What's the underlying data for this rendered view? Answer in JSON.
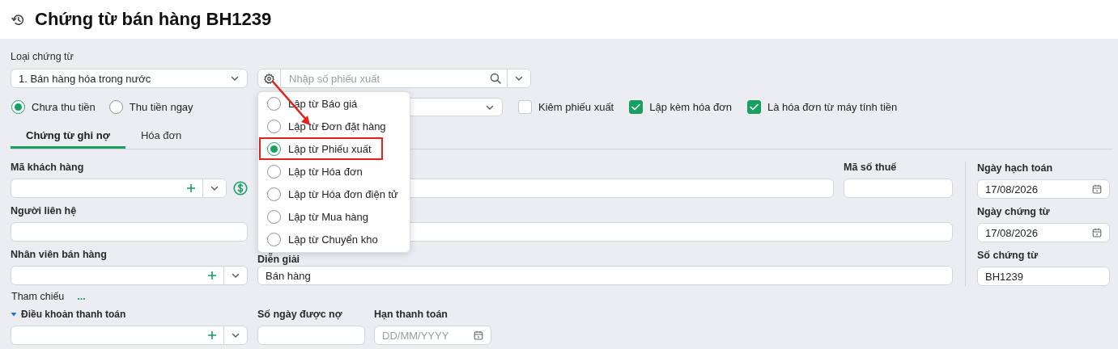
{
  "header": {
    "title": "Chứng từ bán hàng BH1239"
  },
  "voucher_type": {
    "label": "Loại chứng từ",
    "value": "1. Bán hàng hóa trong nước"
  },
  "source_search": {
    "placeholder": "Nhập số phiếu xuất"
  },
  "source_menu": {
    "items": [
      {
        "label": "Lập từ Báo giá",
        "selected": false,
        "highlighted": false
      },
      {
        "label": "Lập từ Đơn đặt hàng",
        "selected": false,
        "highlighted": false
      },
      {
        "label": "Lập từ Phiếu xuất",
        "selected": true,
        "highlighted": true
      },
      {
        "label": "Lập từ Hóa đơn",
        "selected": false,
        "highlighted": false
      },
      {
        "label": "Lập từ Hóa đơn điện tử",
        "selected": false,
        "highlighted": false
      },
      {
        "label": "Lập từ Mua hàng",
        "selected": false,
        "highlighted": false
      },
      {
        "label": "Lập từ Chuyển kho",
        "selected": false,
        "highlighted": false
      }
    ]
  },
  "payment_options": [
    {
      "label": "Chưa thu tiền",
      "selected": true
    },
    {
      "label": "Thu tiền ngay",
      "selected": false
    }
  ],
  "options": [
    {
      "label": "Kiêm phiếu xuất",
      "checked": false
    },
    {
      "label": "Lập kèm hóa đơn",
      "checked": true
    },
    {
      "label": "Là hóa đơn từ máy tính tiền",
      "checked": true
    }
  ],
  "tabs": [
    {
      "label": "Chứng từ ghi nợ",
      "selected": true
    },
    {
      "label": "Hóa đơn",
      "selected": false
    }
  ],
  "customer_code": {
    "label": "Mã khách hàng"
  },
  "tax_code": {
    "label": "Mã số thuế"
  },
  "contact": {
    "label": "Người liên hệ"
  },
  "salesperson": {
    "label": "Nhân viên bán hàng"
  },
  "description": {
    "label": "Diễn giải",
    "value": "Bán hàng"
  },
  "posting_date": {
    "label": "Ngày hạch toán",
    "value": "17/08/2026"
  },
  "voucher_date": {
    "label": "Ngày chứng từ",
    "value": "17/08/2026"
  },
  "voucher_no": {
    "label": "Số chứng từ",
    "value": "BH1239"
  },
  "reference": {
    "label": "Tham chiếu",
    "more": "..."
  },
  "payment_terms": {
    "label": "Điều khoản thanh toán",
    "expanded": true
  },
  "credit_days": {
    "label": "Số ngày được nợ"
  },
  "due_date": {
    "label": "Hạn thanh toán",
    "placeholder": "DD/MM/YYYY"
  }
}
